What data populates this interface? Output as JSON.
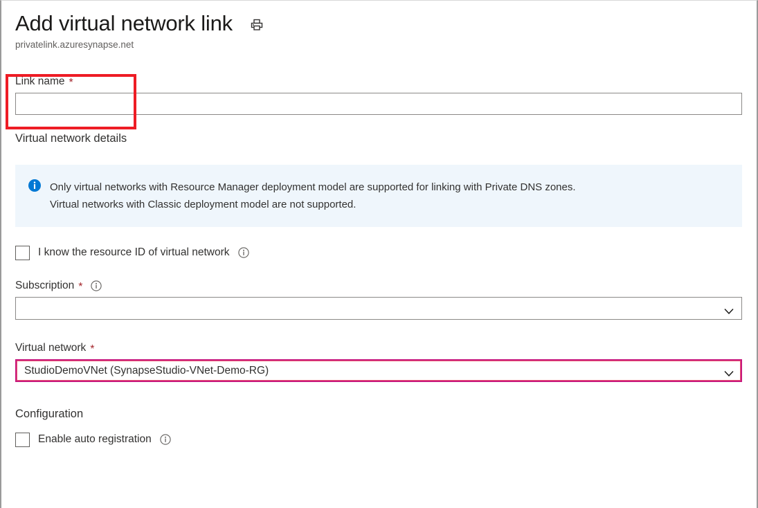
{
  "window": {
    "title": "Add virtual network link",
    "subtitle": "privatelink.azuresynapse.net",
    "print_icon": "printer-icon"
  },
  "colors": {
    "required_asterisk": "#a4262c",
    "info_banner_bg": "#eff6fc",
    "info_icon": "#0078d4",
    "annotation_red": "#ee1c25",
    "highlight_magenta": "#c8197e",
    "input_border": "#8a8886",
    "text": "#323130",
    "subtitle_text": "#605e5c"
  },
  "form": {
    "link_name": {
      "label": "Link name",
      "required": true,
      "asterisk": "*",
      "value": "",
      "placeholder": ""
    },
    "virtual_network_details_heading": "Virtual network details",
    "info_banner": {
      "icon": "info-circle-icon",
      "line1": "Only virtual networks with Resource Manager deployment model are supported for linking with Private DNS zones.",
      "line2": "Virtual networks with Classic deployment model are not supported."
    },
    "know_resource_id": {
      "label": "I know the resource ID of virtual network",
      "checked": false,
      "help_icon": "info-outline-icon"
    },
    "subscription": {
      "label": "Subscription",
      "required": true,
      "asterisk": "*",
      "help_icon": "info-outline-icon",
      "value": "",
      "chevron": "chevron-down-icon"
    },
    "virtual_network": {
      "label": "Virtual network",
      "required": true,
      "asterisk": "*",
      "value": "StudioDemoVNet (SynapseStudio-VNet-Demo-RG)",
      "chevron": "chevron-down-icon",
      "highlighted": true
    },
    "configuration_heading": "Configuration",
    "enable_auto_registration": {
      "label": "Enable auto registration",
      "checked": false,
      "help_icon": "info-outline-icon"
    }
  }
}
